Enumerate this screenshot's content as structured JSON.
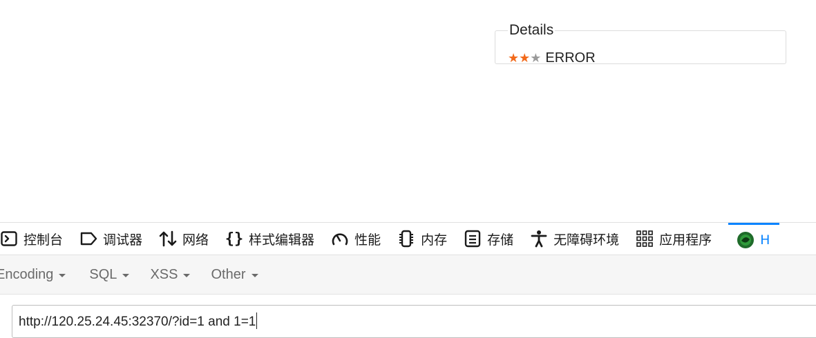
{
  "details": {
    "title": "Details",
    "rating": 2,
    "rating_max": 3,
    "star_color": "#f26a1b",
    "star_empty_color": "#9a9a9a",
    "status_text": "ERROR"
  },
  "devtools": {
    "accent": "#0a84ff",
    "tabs": [
      {
        "label": "控制台",
        "icon": "console-icon"
      },
      {
        "label": "调试器",
        "icon": "debugger-icon"
      },
      {
        "label": "网络",
        "icon": "network-icon"
      },
      {
        "label": "样式编辑器",
        "icon": "style-editor-icon"
      },
      {
        "label": "性能",
        "icon": "performance-icon"
      },
      {
        "label": "内存",
        "icon": "memory-icon"
      },
      {
        "label": "存储",
        "icon": "storage-icon"
      },
      {
        "label": "无障碍环境",
        "icon": "accessibility-icon"
      },
      {
        "label": "应用程序",
        "icon": "application-icon"
      },
      {
        "label": "H",
        "icon": "hackbar-icon",
        "active": true
      }
    ]
  },
  "hackbar": {
    "menu": [
      {
        "label": "Encoding"
      },
      {
        "label": "SQL"
      },
      {
        "label": "XSS"
      },
      {
        "label": "Other"
      }
    ],
    "url_value": "http://120.25.24.45:32370/?id=1 and 1=1"
  }
}
